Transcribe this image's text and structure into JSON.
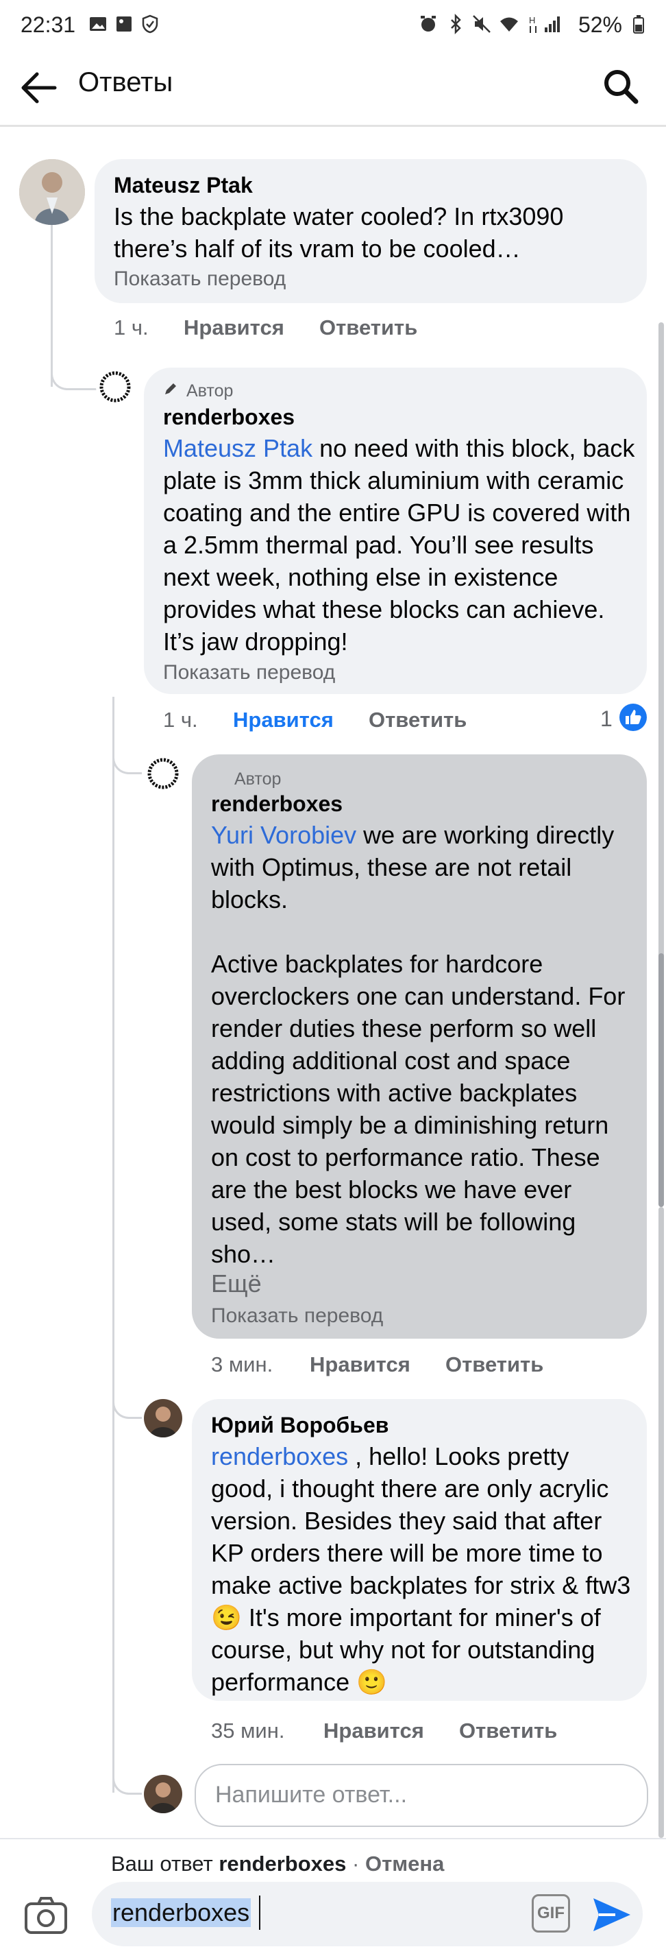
{
  "status_bar": {
    "time": "22:31",
    "battery": "52%"
  },
  "header": {
    "title": "Ответы"
  },
  "comments": [
    {
      "name": "Mateusz Ptak",
      "text": "Is the backplate water cooled? In rtx3090 there’s half of its vram to be cooled…",
      "translate": "Показать перевод",
      "time": "1 ч.",
      "like": "Нравится",
      "reply": "Ответить"
    },
    {
      "author_tag": "Автор",
      "name": "renderboxes",
      "mention": "Mateusz Ptak",
      "text": " no need with this block, back plate is 3mm thick aluminium with ceramic coating and the entire GPU is covered with a 2.5mm thermal pad. You’ll see results next week, nothing else in existence provides what these blocks can achieve. It’s jaw dropping!",
      "translate": "Показать перевод",
      "time": "1 ч.",
      "like": "Нравится",
      "reply": "Ответить",
      "reactions": "1"
    },
    {
      "author_tag": "Автор",
      "name": "renderboxes",
      "mention": "Yuri Vorobiev",
      "text": " we are working directly with Optimus, these are not retail blocks.\n\nActive backplates for hardcore overclockers one can understand. For render duties these perform so well adding additional cost and space restrictions with active backplates would simply be a diminishing return on cost to performance ratio. These are the best blocks we have ever used, some stats will be following sho…",
      "more": "Ещё",
      "translate": "Показать перевод",
      "time": "3 мин.",
      "like": "Нравится",
      "reply": "Ответить"
    },
    {
      "name": "Юрий Воробьев",
      "mention": "renderboxes",
      "text": " , hello! Looks pretty good, i thought there are only acrylic version. Besides they said that after KP orders there will be more time to make active backplates for strix & ftw3 😉 It's more important for miner's of course, but why not for outstanding performance 🙂",
      "time": "35 мин.",
      "like": "Нравится",
      "reply": "Ответить"
    }
  ],
  "reply_input": {
    "placeholder": "Напишите ответ..."
  },
  "reply_bar": {
    "prefix": "Ваш ответ ",
    "target": "renderboxes",
    "separator": " · ",
    "cancel": "Отмена",
    "composer_value": "renderboxes",
    "gif": "GIF"
  },
  "colors": {
    "accent": "#1877f2",
    "mention": "#2d6bd8",
    "bubble": "#f0f2f5",
    "selected_bubble": "#d0d2d5"
  }
}
